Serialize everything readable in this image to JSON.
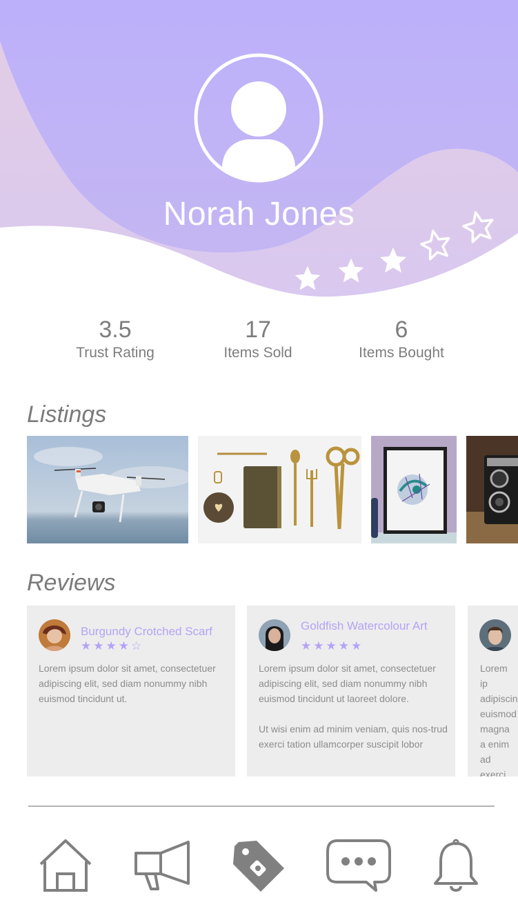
{
  "profile": {
    "name": "Norah Jones",
    "rating_stars": 3
  },
  "stats": [
    {
      "value": "3.5",
      "label": "Trust Rating"
    },
    {
      "value": "17",
      "label": "Items Sold"
    },
    {
      "value": "6",
      "label": "Items Bought"
    }
  ],
  "listings": {
    "title": "Listings",
    "items": [
      "drone-photo",
      "gold-stationery-photo",
      "framed-art-photo",
      "vintage-camera-photo"
    ]
  },
  "reviews": {
    "title": "Reviews",
    "items": [
      {
        "title": "Burgundy Crotched Scarf",
        "stars": 4,
        "stars_text": "★★★★☆",
        "paragraphs": [
          "Lorem ipsum dolor sit amet, consectetuer adipiscing elit, sed diam nonummy nibh euismod tincidunt ut."
        ]
      },
      {
        "title": "Goldfish Watercolour Art",
        "stars": 5,
        "stars_text": "★★★★★",
        "paragraphs": [
          "Lorem ipsum dolor sit amet, consectetuer adipiscing elit, sed diam nonummy nibh euismod tincidunt ut laoreet dolore.",
          "Ut wisi enim ad minim veniam, quis nos-trud exerci tation ullamcorper suscipit lobor"
        ]
      },
      {
        "title": "",
        "paragraphs": [
          "Lorem ip adipiscin euismod magna a enim ad exerci ta"
        ]
      }
    ]
  },
  "nav": {
    "items": [
      "home-icon",
      "megaphone-icon",
      "tag-icon",
      "chat-icon",
      "bell-icon"
    ]
  },
  "colors": {
    "accent": "#b4a3f5",
    "header_top": "#bcb0fb",
    "header_wave": "#dccbe6",
    "card_bg": "#ededed",
    "nav_icon": "#808080"
  }
}
